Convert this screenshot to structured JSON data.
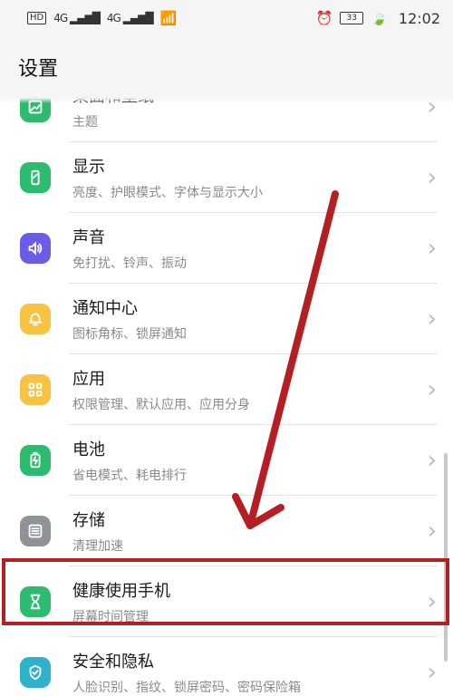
{
  "status_bar": {
    "left_badge": "HD",
    "signal_1": "4G",
    "signal_2": "4G",
    "battery_level": "33",
    "time": "12:02"
  },
  "header": {
    "title": "设置"
  },
  "settings": {
    "items": [
      {
        "title": "桌面和壁纸",
        "subtitle": "主题",
        "icon": "desktop-icon",
        "color": "#2dbb6f"
      },
      {
        "title": "显示",
        "subtitle": "亮度、护眼模式、字体与显示大小",
        "icon": "display-icon",
        "color": "#2dbb6f"
      },
      {
        "title": "声音",
        "subtitle": "免打扰、铃声、振动",
        "icon": "sound-icon",
        "color": "#6a5ce6"
      },
      {
        "title": "通知中心",
        "subtitle": "图标角标、锁屏通知",
        "icon": "notification-bell-icon",
        "color": "#f6c343"
      },
      {
        "title": "应用",
        "subtitle": "权限管理、默认应用、应用分身",
        "icon": "apps-grid-icon",
        "color": "#f6c343"
      },
      {
        "title": "电池",
        "subtitle": "省电模式、耗电排行",
        "icon": "battery-icon",
        "color": "#2dbb6f"
      },
      {
        "title": "存储",
        "subtitle": "清理加速",
        "icon": "storage-icon",
        "color": "#8f9398"
      },
      {
        "title": "健康使用手机",
        "subtitle": "屏幕时间管理",
        "icon": "hourglass-icon",
        "color": "#2dbb6f"
      },
      {
        "title": "安全和隐私",
        "subtitle": "人脸识别、指纹、锁屏密码、密码保险箱",
        "icon": "shield-icon",
        "color": "#2fb2c8"
      }
    ]
  },
  "annotations": {
    "highlight_color": "#b51f23"
  }
}
